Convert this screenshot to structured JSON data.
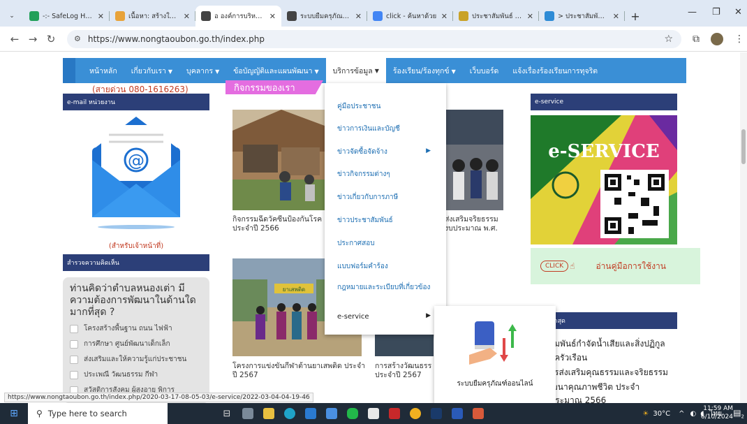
{
  "browser": {
    "tabs": [
      {
        "title": "-:- SafeLog Hot:",
        "color": "#22a05a"
      },
      {
        "title": "เนื้อหา: สร้างใหม่ -",
        "color": "#e8a33a"
      },
      {
        "title": "อ องค์การบริหารส่วน",
        "color": "#444"
      },
      {
        "title": "ระบบยืมครุภัณฑ์ออ",
        "color": "#444"
      },
      {
        "title": "click - ค้นหาด้วย",
        "color": "#4285f4"
      },
      {
        "title": "ประชาสัมพันธ์ เรื่อ",
        "color": "#c9a227"
      },
      {
        "title": "> ประชาสัมพันธ์ก",
        "color": "#2e8bd6"
      }
    ],
    "active_tab_index": 2,
    "new_tab": "+",
    "url": "https://www.nongtaoubon.go.th/index.php",
    "window_controls": [
      "—",
      "❐",
      "✕"
    ]
  },
  "menu": {
    "items": [
      "หน้าหลัก",
      "เกี่ยวกับเรา",
      "บุคลากร",
      "ข้อบัญญัติและแผนพัฒนา",
      "บริการข้อมูล",
      "ร้องเรียน/ร้องทุกข์",
      "เว็บบอร์ด",
      "แจ้งเรื่องร้องเรียนการทุจริต"
    ]
  },
  "left": {
    "hotline": "(สายด่วน 080-1616263)",
    "email_title": "e-mail หน่วยงาน",
    "for_staff": "(สำหรับเจ้าหน้าที่)",
    "survey_title": "สำรวจความคิดเห็น",
    "survey_question": "ท่านคิดว่าตำบลหนองเต่า มีความต้องการพัฒนาในด้านใดมากที่สุด ?",
    "survey_options": [
      "โครงสร้างพื้นฐาน ถนน ไฟฟ้า",
      "การศึกษา ศูนย์พัฒนาเด็กเล็ก",
      "ส่งเสริมและให้ความรู้แก่ประชาชน",
      "ประเพณี วัฒนธรรม กีฬา",
      "สวัสดิการสังคม ผู้สูงอายุ พิการ"
    ]
  },
  "middle": {
    "banner": "กิจกรรมของเรา",
    "captions": [
      "กิจกรรมฉีดวัคซีนป้องกันโรค ประจำปี 2566",
      "ส่งเสริมจริยธรรม งบประมาณ พ.ศ.",
      "โครงการแข่งขันกีฬาต้านยาเสพติด ประจำปี 2567",
      "การสร้างวัฒนธรร ประจำปี 2567"
    ],
    "sign_text": "ยาเสพติด"
  },
  "dropdown": {
    "items": [
      "คู่มือประชาชน",
      "ข่าวการเงินและบัญชี",
      "ข่าวจัดซื้อจัดจ้าง",
      "ข่าวกิจกรรมต่างๆ",
      "ข่าวเกี่ยวกับการภาษี",
      "ข่าวประชาสัมพันธ์",
      "ประกาศสอบ",
      "แบบฟอร์มคำร้อง",
      "กฎหมายและระเบียบที่เกี่ยวข้อง",
      "e-service"
    ],
    "submenu_label": "ระบบยืมครุภัณฑ์ออนไลน์"
  },
  "right": {
    "eservice_title": "e-service",
    "eservice_banner": "e-SERVICE",
    "click_label": "CLICK",
    "manual_text": "อ่านคู่มือการใช้งาน",
    "latest_title": "ล่าสุด",
    "news": [
      "าสัมพันธ์กำจัดน้ำเสียและสิ่งปฏิกูล",
      "ในครัวเรือน",
      "การส่งเสริมคุณธรรมและจริยธรรม",
      "พัฒนาคุณภาพชีวิต ประจำ",
      "บประมาณ 2566"
    ]
  },
  "status_url": "https://www.nongtaoubon.go.th/index.php/2020-03-17-08-05-03/e-service/2022-03-04-04-19-46",
  "taskbar": {
    "search_placeholder": "Type here to search",
    "weather": "30°C",
    "lang": "ไทย",
    "time": "11:59 AM",
    "date": "6/10/2024",
    "notifications": "2"
  }
}
